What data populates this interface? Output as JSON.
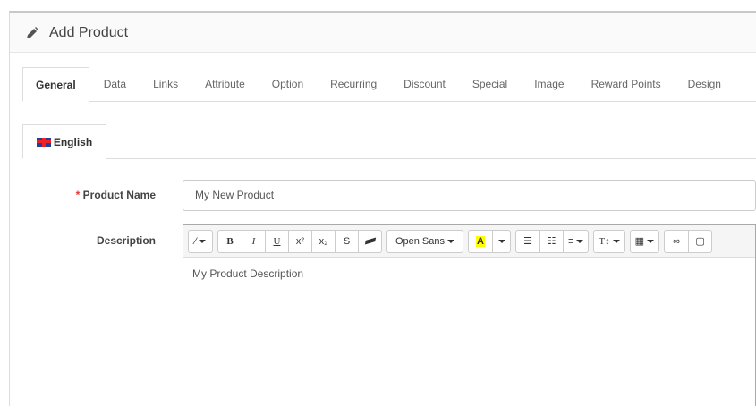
{
  "header": {
    "title": "Add Product",
    "icon": "pencil-icon"
  },
  "tabs": [
    "General",
    "Data",
    "Links",
    "Attribute",
    "Option",
    "Recurring",
    "Discount",
    "Special",
    "Image",
    "Reward Points",
    "Design"
  ],
  "language_tab": {
    "label": "English",
    "icon": "uk-flag-icon"
  },
  "form": {
    "product_name_label": "Product Name",
    "required_marker": "*",
    "product_name_value": "My New Product",
    "description_label": "Description",
    "description_value": "My Product Description"
  },
  "toolbar": {
    "bold": "B",
    "italic": "I",
    "underline": "U",
    "superscript": "x²",
    "subscript": "x₂",
    "strike": "S",
    "font": "Open Sans",
    "color": "A",
    "fontsize": "T↕"
  }
}
